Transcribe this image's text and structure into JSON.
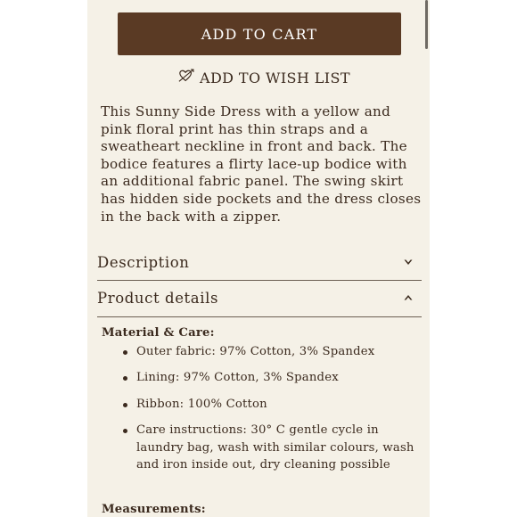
{
  "buttons": {
    "add_to_cart": "ADD TO CART",
    "add_to_wishlist": "ADD TO WISH LIST"
  },
  "product": {
    "description_text": "This Sunny Side Dress with a yellow and pink floral print has thin straps and a sweatheart neckline in front and back. The bodice features a flirty lace-up bodice with an additional fabric panel. The swing skirt has hidden side pockets and the dress closes in the back with a zipper."
  },
  "accordion": {
    "description": {
      "label": "Description",
      "icon": "chevron-down-icon",
      "expanded": false
    },
    "product_details": {
      "label": "Product details",
      "icon": "chevron-up-icon",
      "expanded": true
    }
  },
  "details": {
    "material_heading": "Material & Care:",
    "items": [
      "Outer fabric: 97% Cotton, 3% Spandex",
      "Lining: 97% Cotton, 3% Spandex",
      "Ribbon: 100% Cotton",
      "Care instructions: 30° C gentle cycle in laundry bag, wash with similar colours, wash and iron inside out, dry cleaning possible"
    ],
    "measurements_heading": "Measurements:"
  },
  "colors": {
    "button_bg": "#5a3a24",
    "panel_bg": "#f5f1e7",
    "text": "#3b2a1e"
  }
}
